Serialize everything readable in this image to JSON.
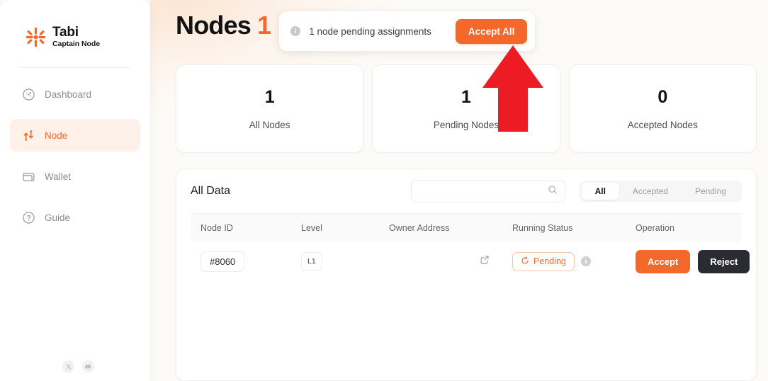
{
  "sidebar": {
    "brand": {
      "name": "Tabi",
      "subtitle": "Captain Node",
      "logo_icon": "tabi-asterisk-logo"
    },
    "items": [
      {
        "label": "Dashboard",
        "icon": "gauge-icon",
        "active": false
      },
      {
        "label": "Node",
        "icon": "nodes-arrows-icon",
        "active": true
      },
      {
        "label": "Wallet",
        "icon": "wallet-icon",
        "active": false
      },
      {
        "label": "Guide",
        "icon": "question-circle-icon",
        "active": false
      }
    ],
    "social": [
      {
        "name": "x-twitter-icon",
        "glyph": "𝕏"
      },
      {
        "name": "discord-icon",
        "glyph": "discord"
      }
    ]
  },
  "header": {
    "title": "Nodes",
    "count": "1",
    "notice": {
      "info_icon": "info-circle-icon",
      "text": "1 node pending assignments",
      "accept_all_label": "Accept All"
    }
  },
  "stats": [
    {
      "value": "1",
      "label": "All Nodes"
    },
    {
      "value": "1",
      "label": "Pending Nodes"
    },
    {
      "value": "0",
      "label": "Accepted Nodes"
    }
  ],
  "panel": {
    "title": "All Data",
    "search": {
      "value": "",
      "placeholder": "",
      "icon": "search-icon"
    },
    "filters": [
      {
        "label": "All",
        "active": true
      },
      {
        "label": "Accepted",
        "active": false
      },
      {
        "label": "Pending",
        "active": false
      }
    ],
    "columns": [
      "Node ID",
      "Level",
      "Owner Address",
      "Running Status",
      "Operation"
    ],
    "rows": [
      {
        "node_id": "#8060",
        "level": "L1",
        "owner_address": "",
        "owner_link_icon": "external-link-icon",
        "status": {
          "label": "Pending",
          "icon": "refresh-circle-icon"
        },
        "status_info_icon": "info-circle-icon",
        "accept_label": "Accept",
        "reject_label": "Reject"
      }
    ]
  },
  "annotation": {
    "arrow": "red-up-arrow",
    "color": "#ED1C24"
  },
  "colors": {
    "accent_orange": "#F4692A",
    "dark_button": "#2B2B33",
    "page_bg": "#FDFBF8",
    "annotation_red": "#ED1C24"
  }
}
